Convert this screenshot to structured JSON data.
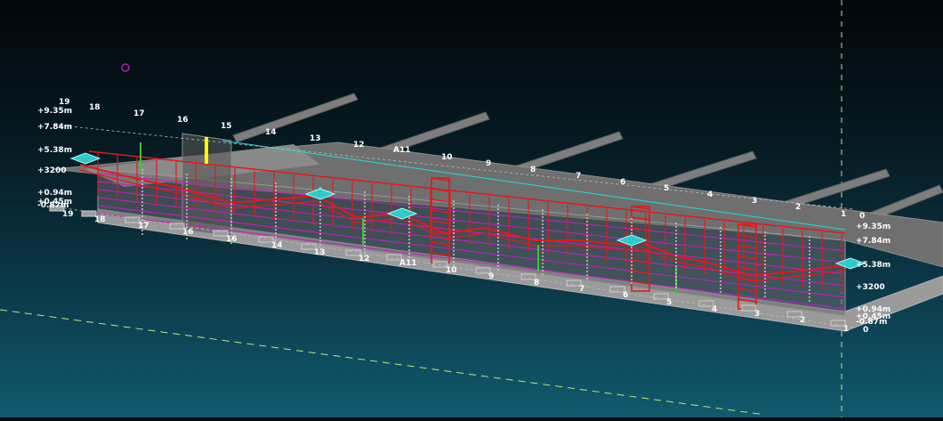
{
  "colors": {
    "background_top": "#02070b",
    "background_bottom": "#115a6e",
    "structure": "#8a8a8a",
    "rebar_red": "#e11a1a",
    "rebar_magenta": "#c21fc2",
    "rebar_green": "#3cc43c",
    "cyan_plate": "#2fc9c9",
    "yellow_marker": "#ffff00",
    "label": "#ffffff"
  },
  "scene": {
    "front_grid_labels": [
      "19",
      "18",
      "17",
      "16",
      "16",
      "14",
      "13",
      "12",
      "A11",
      "10",
      "9",
      "8",
      "7",
      "6",
      "5",
      "4",
      "3",
      "2",
      "1",
      "0"
    ],
    "top_grid_labels": [
      "19",
      "18",
      "17",
      "16",
      "15",
      "14",
      "13",
      "12",
      "A11",
      "10",
      "9",
      "8",
      "7",
      "6",
      "5",
      "4",
      "3",
      "2",
      "1",
      "0"
    ],
    "left_elevations": [
      "+9.35m",
      "+7.84m",
      "+5.38m",
      "+3200",
      "+0.94m",
      "+0.45m",
      "-0.87m"
    ],
    "right_elevations": [
      "+9.35m",
      "+7.84m",
      "+5.38m",
      "+3200",
      "+0.94m",
      "+0.45m",
      "-0.87m"
    ]
  }
}
